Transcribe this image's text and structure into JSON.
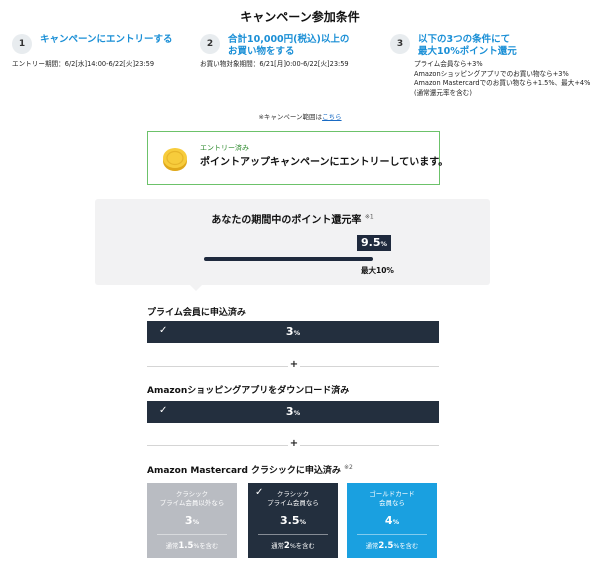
{
  "title": "キャンペーン参加条件",
  "steps": [
    {
      "num": "1",
      "head": [
        "キャンペーンにエントリーする"
      ],
      "body": [
        "エントリー期間：6/2[水]14:00-6/22[火]23:59"
      ]
    },
    {
      "num": "2",
      "head": [
        "合計10,000円(税込)以上の",
        "お買い物をする"
      ],
      "body": [
        "お買い物対象期間：6/21[月]0:00-6/22[火]23:59"
      ]
    },
    {
      "num": "3",
      "head": [
        "以下の3つの条件にて",
        "最大10%ポイント還元"
      ],
      "body": [
        "プライム会員なら+3%",
        "Amazonショッピングアプリでのお買い物なら+3%",
        "Amazon Mastercardでのお買い物なら+1.5%、最大+4%",
        "(通常還元率を含む)"
      ]
    }
  ],
  "scope_note": {
    "text": "※キャンペーン範囲は",
    "link": "こちら"
  },
  "entry": {
    "status": "エントリー済み",
    "message": "ポイントアップキャンペーンにエントリーしています。"
  },
  "rate": {
    "title": "あなたの期間中のポイント還元率",
    "note_mark": "※1",
    "value": "9.5",
    "unit": "%",
    "max_label": "最大10%",
    "progress_fraction": 0.95
  },
  "conditions": [
    {
      "label": "プライム会員に申込済み",
      "check": "✓",
      "value": "3",
      "unit": "%"
    },
    {
      "label": "Amazonショッピングアプリをダウンロード済み",
      "check": "✓",
      "value": "3",
      "unit": "%"
    }
  ],
  "plus_sign": "+",
  "mastercard": {
    "label": "Amazon Mastercard クラシックに申込済み",
    "note_mark": "※2",
    "cards": [
      {
        "title": [
          "クラシック",
          "プライム会員以外なら"
        ],
        "value": "3",
        "unit": "%",
        "note_pre": "通常",
        "note_val": "1.5",
        "note_post": "%を含む",
        "selected": false
      },
      {
        "title": [
          "クラシック",
          "プライム会員なら"
        ],
        "value": "3.5",
        "unit": "%",
        "note_pre": "通常",
        "note_val": "2",
        "note_post": "%を含む",
        "selected": true,
        "check": "✓"
      },
      {
        "title": [
          "ゴールドカード",
          "会員なら"
        ],
        "value": "4",
        "unit": "%",
        "note_pre": "通常",
        "note_val": "2.5",
        "note_post": "%を含む",
        "selected": false
      }
    ]
  },
  "colors": {
    "accent_blue": "#1a8fd6",
    "navy": "#232f3e",
    "green_border": "#6cc26a",
    "gold_blue": "#1aa0e0",
    "grey_card": "#b9bcc2"
  },
  "icons": {
    "entry": "coin-icon",
    "check": "check-icon"
  }
}
